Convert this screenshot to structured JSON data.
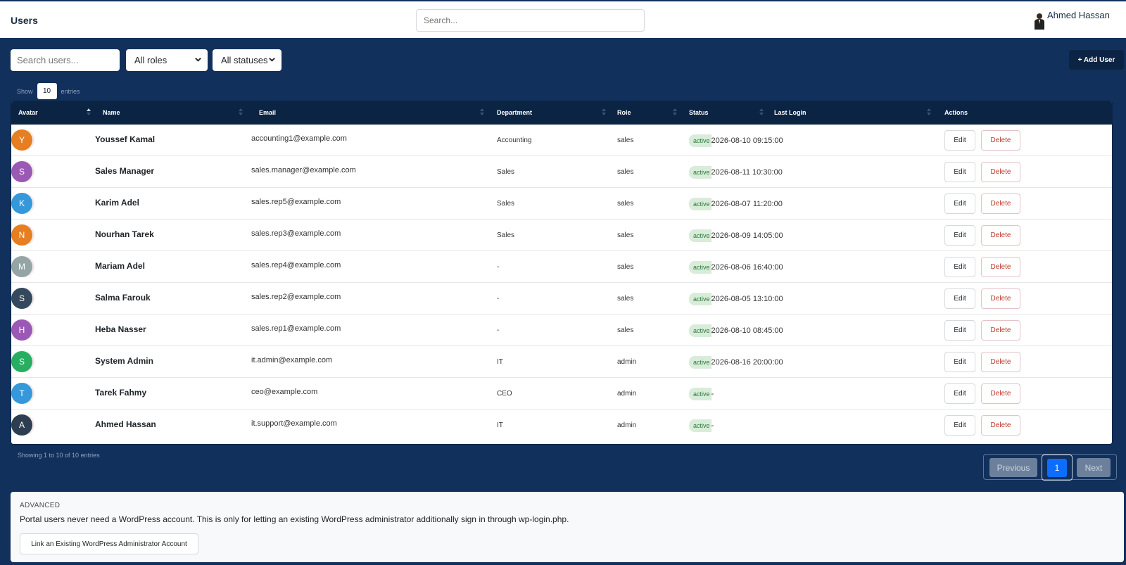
{
  "header": {
    "page_title": "Users",
    "search_placeholder": "Search...",
    "user_name": "Ahmed Hassan"
  },
  "filters": {
    "search_placeholder": "Search users...",
    "role_selected": "All roles",
    "status_selected": "All statuses",
    "add_user_label": "+ Add User"
  },
  "entries": {
    "show_label": "Show",
    "value": "10",
    "suffix": "entries"
  },
  "table": {
    "columns": [
      "Avatar",
      "Name",
      "Email",
      "Department",
      "Role",
      "Status",
      "Last Login",
      "Actions"
    ],
    "rows": [
      {
        "initial": "Y",
        "color": "#e67e22",
        "name": "Youssef Kamal",
        "email": "accounting1@example.com",
        "department": "Accounting",
        "role": "sales",
        "status": "active",
        "last_login": "2026-08-10 09:15:00"
      },
      {
        "initial": "S",
        "color": "#9b59b6",
        "name": "Sales Manager",
        "email": "sales.manager@example.com",
        "department": "Sales",
        "role": "sales",
        "status": "active",
        "last_login": "2026-08-11 10:30:00"
      },
      {
        "initial": "K",
        "color": "#3498db",
        "name": "Karim Adel",
        "email": "sales.rep5@example.com",
        "department": "Sales",
        "role": "sales",
        "status": "active",
        "last_login": "2026-08-07 11:20:00"
      },
      {
        "initial": "N",
        "color": "#e67e22",
        "name": "Nourhan Tarek",
        "email": "sales.rep3@example.com",
        "department": "Sales",
        "role": "sales",
        "status": "active",
        "last_login": "2026-08-09 14:05:00"
      },
      {
        "initial": "M",
        "color": "#95a5a6",
        "name": "Mariam Adel",
        "email": "sales.rep4@example.com",
        "department": "-",
        "role": "sales",
        "status": "active",
        "last_login": "2026-08-06 16:40:00"
      },
      {
        "initial": "S",
        "color": "#34495e",
        "name": "Salma Farouk",
        "email": "sales.rep2@example.com",
        "department": "-",
        "role": "sales",
        "status": "active",
        "last_login": "2026-08-05 13:10:00"
      },
      {
        "initial": "H",
        "color": "#9b59b6",
        "name": "Heba Nasser",
        "email": "sales.rep1@example.com",
        "department": "-",
        "role": "sales",
        "status": "active",
        "last_login": "2026-08-10 08:45:00"
      },
      {
        "initial": "S",
        "color": "#27ae60",
        "name": "System Admin",
        "email": "it.admin@example.com",
        "department": "IT",
        "role": "admin",
        "status": "active",
        "last_login": "2026-08-16 20:00:00"
      },
      {
        "initial": "T",
        "color": "#3498db",
        "name": "Tarek Fahmy",
        "email": "ceo@example.com",
        "department": "CEO",
        "role": "admin",
        "status": "active",
        "last_login": "-"
      },
      {
        "initial": "A",
        "color": "#2c3e50",
        "name": "Ahmed Hassan",
        "email": "it.support@example.com",
        "department": "IT",
        "role": "admin",
        "status": "active",
        "last_login": "-"
      }
    ],
    "edit_label": "Edit",
    "delete_label": "Delete"
  },
  "footer": {
    "showing_text": "Showing 1 to 10 of 10 entries",
    "prev_label": "Previous",
    "current_page": "1",
    "next_label": "Next"
  },
  "advanced": {
    "title": "ADVANCED",
    "description": "Portal users never need a WordPress account. This is only for letting an existing WordPress administrator additionally sign in through wp-login.php.",
    "button_label": "Link an Existing WordPress Administrator Account"
  }
}
